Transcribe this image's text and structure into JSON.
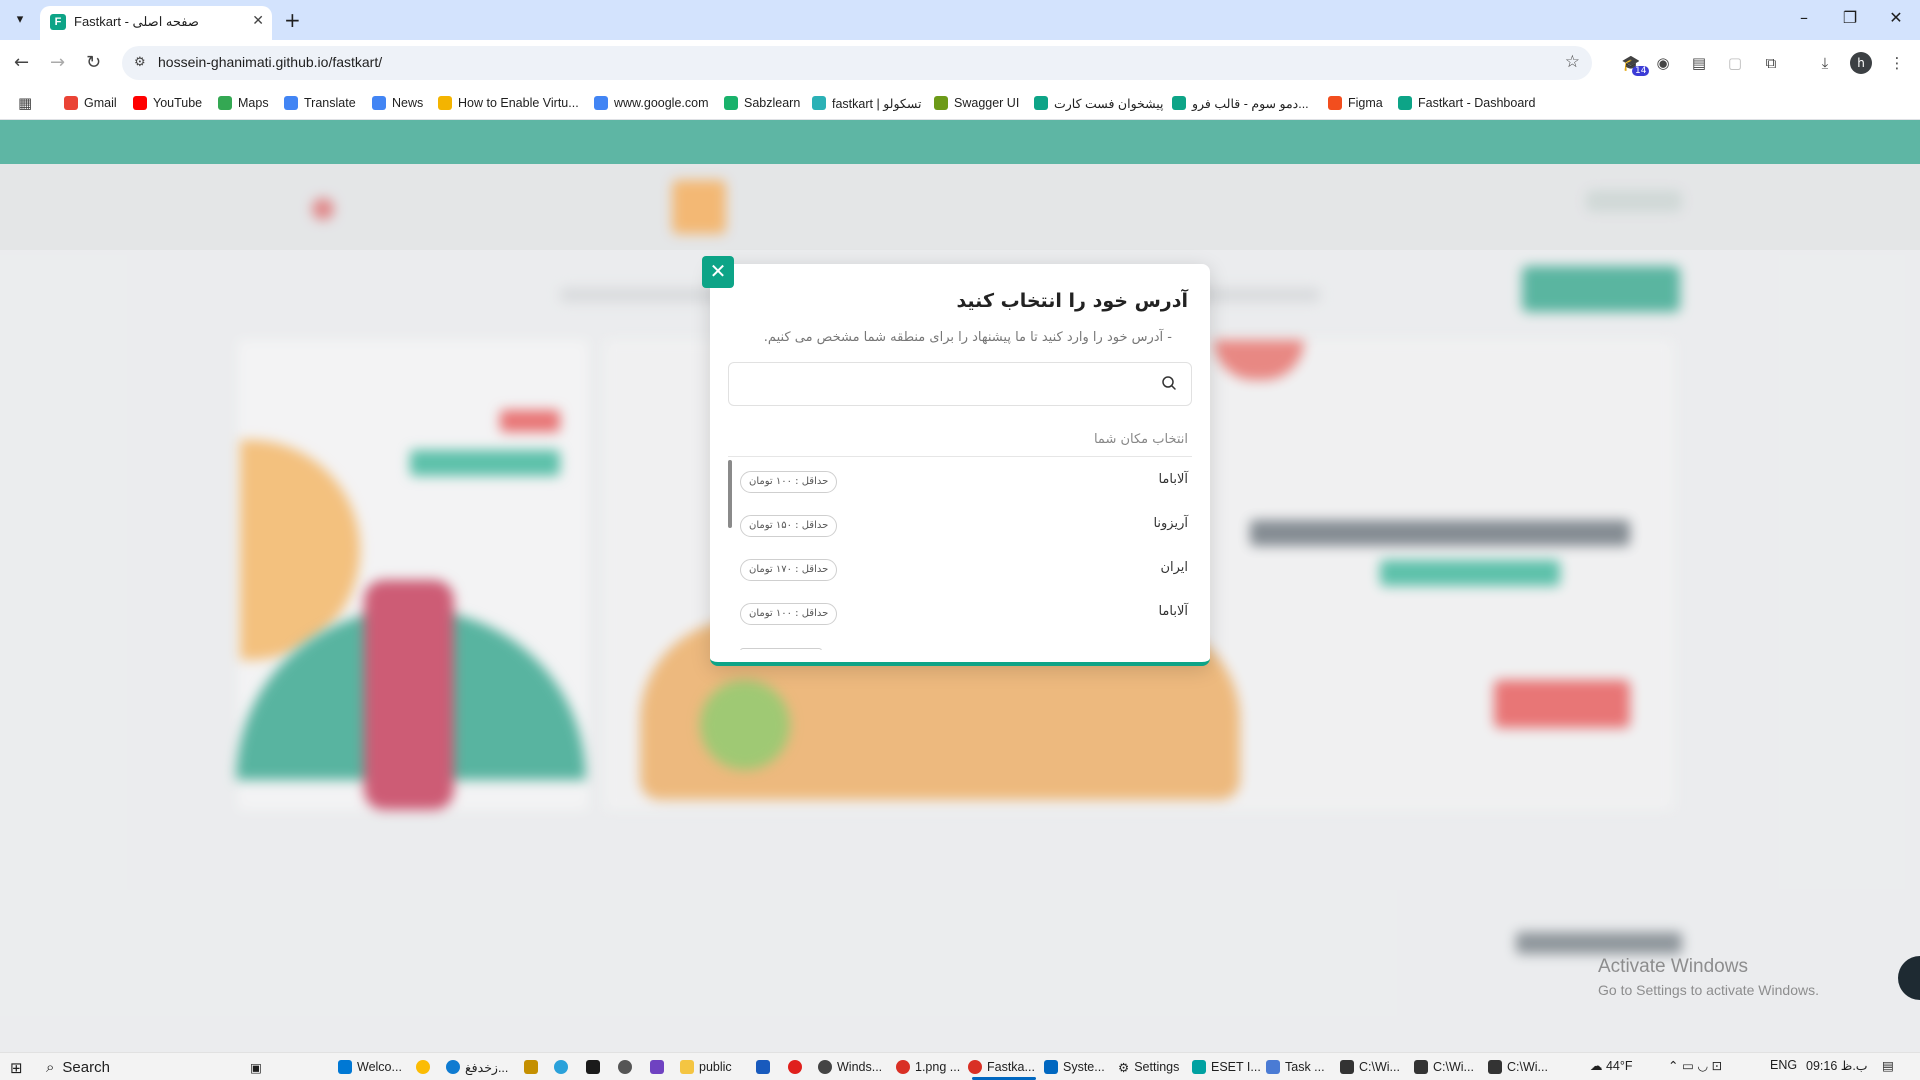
{
  "browser": {
    "tab_title": "Fastkart - صفحه اصلی",
    "favicon_letter": "F",
    "url": "hossein-ghanimati.github.io/fastkart/",
    "extension_badge": "14",
    "profile_initial": "h"
  },
  "bookmarks": [
    {
      "label": "Gmail",
      "icon": "gmail-icon",
      "color": "#ea4335"
    },
    {
      "label": "YouTube",
      "icon": "youtube-icon",
      "color": "#ff0000"
    },
    {
      "label": "Maps",
      "icon": "maps-icon",
      "color": "#34a853"
    },
    {
      "label": "Translate",
      "icon": "translate-icon",
      "color": "#4285f4"
    },
    {
      "label": "News",
      "icon": "news-icon",
      "color": "#4285f4"
    },
    {
      "label": "How to Enable Virtu...",
      "icon": "site-icon",
      "color": "#f4b400"
    },
    {
      "label": "www.google.com",
      "icon": "google-icon",
      "color": "#4285f4"
    },
    {
      "label": "Sabzlearn",
      "icon": "sabzlearn-icon",
      "color": "#19b26b"
    },
    {
      "label": "fastkart | تسکولو",
      "icon": "taskulu-icon",
      "color": "#2bb1b6"
    },
    {
      "label": "Swagger UI",
      "icon": "swagger-icon",
      "color": "#6c9a18"
    },
    {
      "label": "پیشخوان فست کارت",
      "icon": "fastkart-icon",
      "color": "#0da487"
    },
    {
      "label": "دمو سوم - قالب فرو...",
      "icon": "fastkart-icon",
      "color": "#0da487"
    },
    {
      "label": "Figma",
      "icon": "figma-icon",
      "color": "#f24e1e"
    },
    {
      "label": "Fastkart - Dashboard",
      "icon": "fastkart-icon",
      "color": "#0da487"
    }
  ],
  "modal": {
    "title": "آدرس خود را انتخاب کنید",
    "subtitle": "- آدرس خود را وارد کنید تا ما پیشنهاد را برای منطقه شما مشخص می کنیم.",
    "search_placeholder": "",
    "section_label": "انتخاب مکان شما",
    "locations": [
      {
        "city": "آلاباما",
        "min": "حداقل : ۱۰۰ تومان"
      },
      {
        "city": "آریزونا",
        "min": "حداقل : ۱۵۰ تومان"
      },
      {
        "city": "ایران",
        "min": "حداقل : ۱۷۰ تومان"
      },
      {
        "city": "آلاباما",
        "min": "حداقل : ۱۰۰ تومان"
      },
      {
        "city": "",
        "min": ""
      }
    ]
  },
  "watermark": {
    "line1": "Activate Windows",
    "line2": "Go to Settings to activate Windows."
  },
  "taskbar": {
    "search_label": "Search",
    "items": [
      {
        "label": "Welco...",
        "color": "#0078d4"
      },
      {
        "label": "",
        "color": "#fbbc04"
      },
      {
        "label": "زخدفغ...",
        "color": "#0f7bd1"
      },
      {
        "label": "",
        "color": "#c48f00"
      },
      {
        "label": "",
        "color": "#2aa1da"
      },
      {
        "label": "",
        "color": "#1a1a1a"
      },
      {
        "label": "",
        "color": "#555"
      },
      {
        "label": "",
        "color": "#6f42c1"
      },
      {
        "label": "public",
        "color": "#f4c542"
      },
      {
        "label": "",
        "color": "#185abd"
      },
      {
        "label": "",
        "color": "#e0201c"
      },
      {
        "label": "Winds...",
        "color": "#444"
      },
      {
        "label": "1.png ...",
        "color": "#d93025"
      },
      {
        "label": "Fastka...",
        "color": "#d93025"
      },
      {
        "label": "Syste...",
        "color": "#0067c0"
      },
      {
        "label": "Settings",
        "color": "#555"
      },
      {
        "label": "ESET I...",
        "color": "#00a1a1"
      },
      {
        "label": "Task ...",
        "color": "#4a7bd4"
      },
      {
        "label": "C:\\Wi...",
        "color": "#333"
      },
      {
        "label": "C:\\Wi...",
        "color": "#333"
      },
      {
        "label": "C:\\Wi...",
        "color": "#333"
      }
    ],
    "weather": "44°F",
    "language": "ENG",
    "clock": "09:16 ب.ظ"
  },
  "colors": {
    "brand": "#0da487",
    "accent_orange": "#ffa53b",
    "accent_red": "#ef3f3e"
  }
}
